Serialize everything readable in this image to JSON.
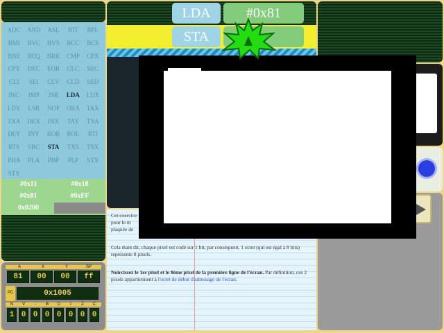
{
  "opcodes": [
    "ADC",
    "AND",
    "ASL",
    "BIT",
    "BPL",
    "BMI",
    "BVC",
    "BVS",
    "BCC",
    "BCS",
    "BNE",
    "BEQ",
    "BRK",
    "CMP",
    "CPX",
    "CPY",
    "DEC",
    "EOR",
    "CLC",
    "SEC",
    "CLI",
    "SEI",
    "CLV",
    "CLD",
    "SED",
    "INC",
    "JMP",
    "JSR",
    "LDA",
    "LDX",
    "LDY",
    "LSR",
    "NOP",
    "ORA",
    "TAX",
    "TXA",
    "DEX",
    "INX",
    "TAY",
    "TYA",
    "DEY",
    "INY",
    "ROR",
    "ROL",
    "RTI",
    "RTS",
    "SBC",
    "STA",
    "TXS",
    "TSX",
    "PHA",
    "PLA",
    "PHP",
    "PLP",
    "STX",
    "STY"
  ],
  "highlighted_opcodes": [
    "LDA",
    "STA"
  ],
  "memory": {
    "cell_1": "#0x11",
    "cell_2": "#0x18",
    "cell_3": "#0x81",
    "cell_4": "#0xFF",
    "cell_5": "0x0200"
  },
  "registers": {
    "labels": [
      "A",
      "X",
      "Y",
      "SP"
    ],
    "values": [
      "81",
      "00",
      "00",
      "ff"
    ],
    "pc_label": "PC",
    "pc_value": "0x1005",
    "flag_labels": [
      "N",
      "V",
      "-",
      "B",
      "D",
      "I",
      "Z",
      "C"
    ],
    "flag_values": [
      "1",
      "0",
      "0",
      "0",
      "0",
      "0",
      "0",
      "0"
    ]
  },
  "instructions": [
    {
      "op": "LDA",
      "arg": "#0x81"
    },
    {
      "op": "STA",
      "arg": ""
    }
  ],
  "doc": {
    "p1_start": "Cet exercice",
    "p1_rest": "pour le m",
    "p1_end": "plaquée de",
    "p2": "Cela étant dit, chaque pixel est codé sur 1 bit, par conséquent, 1 octet (qui est égal à 8 bits) représente 8 pixels.",
    "p3_bold": "Noircissez le 1er pixel et le 8ème pixel de la première ligne de l'écran.",
    "p3_rest": "Par définition, ces 2 pixels appartiennent à",
    "p3_link": "l'octet de début d'adressage de l'écran."
  },
  "colors": {
    "panel_blue": "#8ec8dc",
    "memory_green": "#9dd68f",
    "accent_yellow": "#f4ef2e",
    "button_blue": "#9fd3e6",
    "button_green": "#82cc7c",
    "star_green": "#22dd10",
    "run_blue": "#2a3fe0"
  }
}
